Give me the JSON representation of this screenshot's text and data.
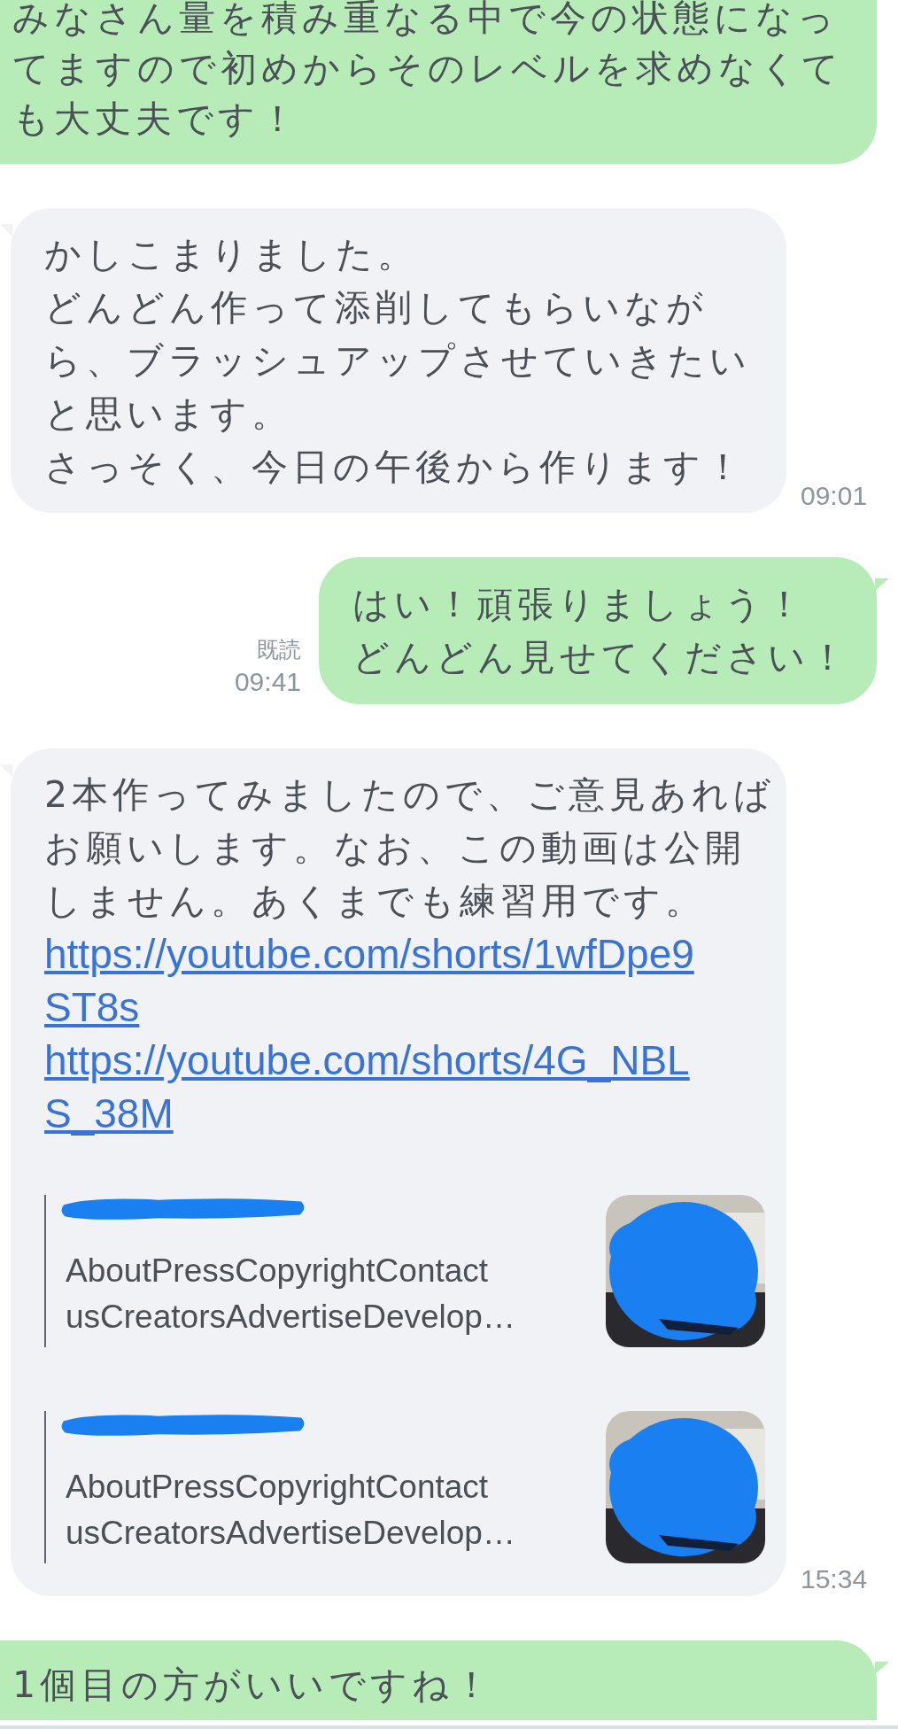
{
  "messages": [
    {
      "kind": "outgoing",
      "paragraphs": [
        "みなさん量を積み重なる中で今の状態になってますので初めからそのレベルを求めなくても大丈夫です！"
      ]
    },
    {
      "kind": "incoming",
      "paragraphs": [
        "かしこまりました。",
        "どんどん作って添削してもらいながら、ブラッシュアップさせていきたいと思います。",
        "さっそく、今日の午後から作ります！"
      ],
      "time": "09:01"
    },
    {
      "kind": "outgoing",
      "read_label": "既読",
      "time": "09:41",
      "paragraphs": [
        "はい！頑張りましょう！",
        "どんどん見せてください！"
      ]
    },
    {
      "kind": "incoming",
      "time": "15:34",
      "segments": [
        {
          "kind": "text",
          "text": "2本作ってみましたので、ご意見あればお願いします。なお、この動画は公開しません。あくまでも練習用です。"
        },
        {
          "kind": "link",
          "text": "https://youtube.com/shorts/1wfDpe9ST8s"
        },
        {
          "kind": "link",
          "text": "https://youtube.com/shorts/4G_NBLS_38M"
        }
      ],
      "previews": [
        {
          "description_lines": [
            "AboutPressCopyrightContact",
            "usCreatorsAdvertiseDevelop…"
          ],
          "thumbnail": {
            "kind": "picture"
          }
        },
        {
          "description_lines": [
            "AboutPressCopyrightContact",
            "usCreatorsAdvertiseDevelop…"
          ],
          "thumbnail": {
            "kind": "picture"
          }
        }
      ]
    },
    {
      "kind": "outgoing",
      "paragraphs": [
        "1個目の方がいいですね！"
      ]
    }
  ]
}
